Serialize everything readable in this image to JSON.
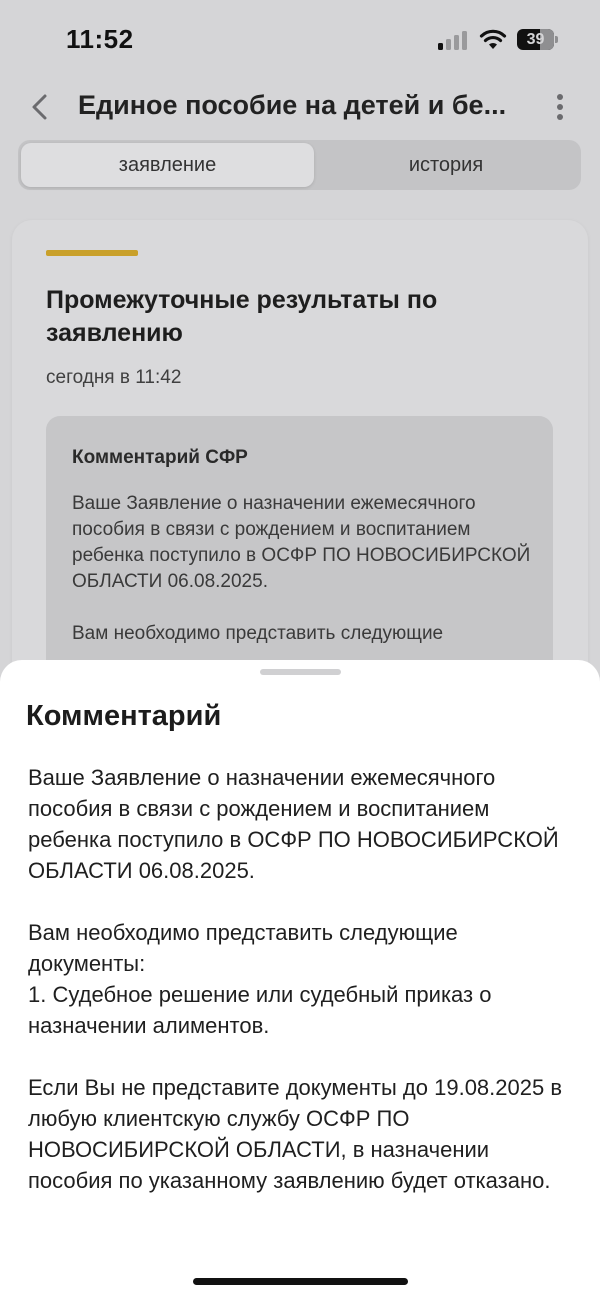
{
  "status_bar": {
    "time": "11:52",
    "battery": "39",
    "icons": [
      "signal-icon",
      "wifi-icon",
      "battery-icon"
    ]
  },
  "nav": {
    "title": "Единое пособие на детей и бе...",
    "icons": [
      "chevron-left-icon",
      "more-vertical-icon"
    ]
  },
  "tabs": [
    {
      "label": "заявление",
      "active": true
    },
    {
      "label": "история",
      "active": false
    }
  ],
  "card": {
    "accent_color": "#c9a02a",
    "title": "Промежуточные результаты по заявлению",
    "date": "сегодня в 11:42",
    "comment_title": "Комментарий СФР",
    "comment_paragraphs": [
      "Ваше Заявление о назначении ежемесячного пособия в связи с рождением и воспитанием ребенка поступило в ОСФР ПО НОВОСИБИРСКОЙ ОБЛАСТИ 06.08.2025.",
      "Вам необходимо представить следующие"
    ]
  },
  "sheet": {
    "title": "Комментарий",
    "paragraphs": [
      "Ваше Заявление о назначении ежемесячного пособия в связи с рождением и воспитанием ребенка поступило в ОСФР ПО НОВОСИБИРСКОЙ ОБЛАСТИ 06.08.2025.",
      "Вам необходимо представить следующие документы:\n1. Судебное решение или судебный приказ о назначении алиментов.",
      "Если Вы не представите документы до 19.08.2025 в любую клиентскую службу ОСФР ПО НОВОСИБИРСКОЙ ОБЛАСТИ, в назначении пособия по указанному заявлению будет отказано."
    ]
  }
}
